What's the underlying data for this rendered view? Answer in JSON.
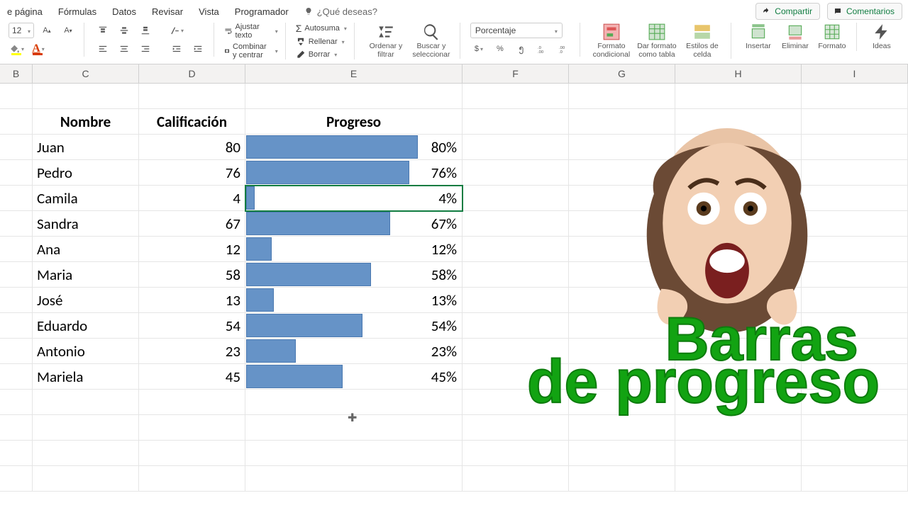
{
  "menu": {
    "tabs": [
      "e página",
      "Fórmulas",
      "Datos",
      "Revisar",
      "Vista",
      "Programador"
    ],
    "tell_me": "¿Qué deseas?",
    "share": "Compartir",
    "comments": "Comentarios"
  },
  "ribbon": {
    "font_size": "12",
    "wrap_text": "Ajustar texto",
    "merge": "Combinar y centrar",
    "autosum": "Autosuma",
    "fill": "Rellenar",
    "clear": "Borrar",
    "sort": "Ordenar y filtrar",
    "find": "Buscar y seleccionar",
    "number_format": "Porcentaje",
    "cond_format": "Formato condicional",
    "as_table": "Dar formato como tabla",
    "cell_styles": "Estilos de celda",
    "insert": "Insertar",
    "delete": "Eliminar",
    "format": "Formato",
    "ideas": "Ideas"
  },
  "columns": [
    "B",
    "C",
    "D",
    "E",
    "F",
    "G",
    "H",
    "I"
  ],
  "headers": {
    "name": "Nombre",
    "score": "Calificación",
    "progress": "Progreso"
  },
  "rows": [
    {
      "name": "Juan",
      "score": 80,
      "pct": "80%",
      "bar": 80,
      "selected": false
    },
    {
      "name": "Pedro",
      "score": 76,
      "pct": "76%",
      "bar": 76,
      "selected": false
    },
    {
      "name": "Camila",
      "score": 4,
      "pct": "4%",
      "bar": 4,
      "selected": true
    },
    {
      "name": "Sandra",
      "score": 67,
      "pct": "67%",
      "bar": 67,
      "selected": false
    },
    {
      "name": "Ana",
      "score": 12,
      "pct": "12%",
      "bar": 12,
      "selected": false
    },
    {
      "name": "Maria",
      "score": 58,
      "pct": "58%",
      "bar": 58,
      "selected": false
    },
    {
      "name": "José",
      "score": 13,
      "pct": "13%",
      "bar": 13,
      "selected": false
    },
    {
      "name": "Eduardo",
      "score": 54,
      "pct": "54%",
      "bar": 54,
      "selected": false
    },
    {
      "name": "Antonio",
      "score": 23,
      "pct": "23%",
      "bar": 23,
      "selected": false
    },
    {
      "name": "Mariela",
      "score": 45,
      "pct": "45%",
      "bar": 45,
      "selected": false
    }
  ],
  "overlay": {
    "line1": "Barras",
    "line2": "de progreso"
  },
  "chart_data": {
    "type": "bar",
    "title": "Progreso",
    "categories": [
      "Juan",
      "Pedro",
      "Camila",
      "Sandra",
      "Ana",
      "Maria",
      "José",
      "Eduardo",
      "Antonio",
      "Mariela"
    ],
    "values": [
      80,
      76,
      4,
      67,
      12,
      58,
      13,
      54,
      23,
      45
    ],
    "xlabel": "",
    "ylabel": "",
    "ylim": [
      0,
      100
    ]
  }
}
